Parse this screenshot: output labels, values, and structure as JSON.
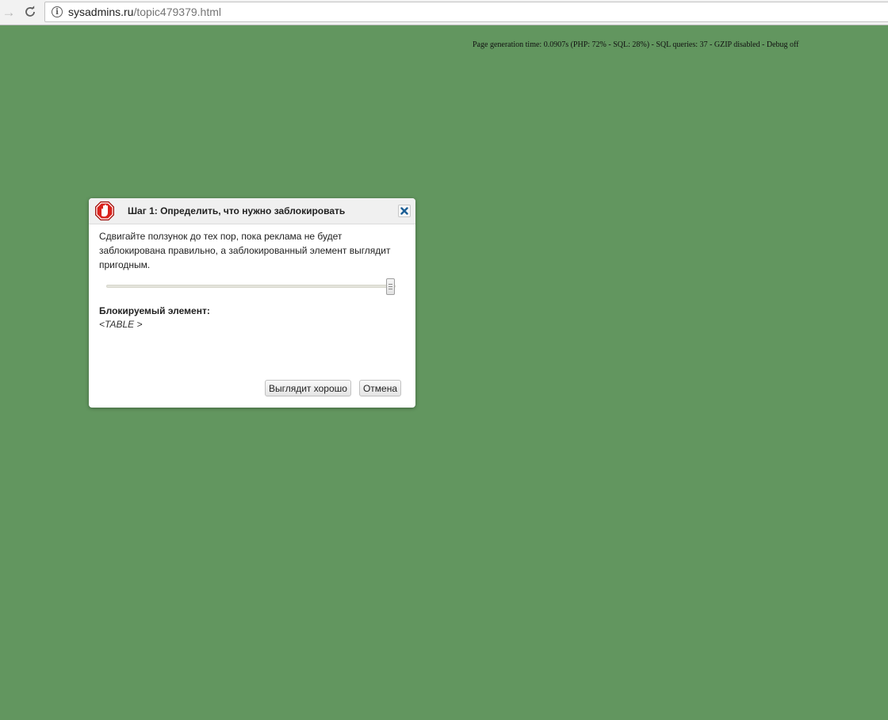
{
  "browser": {
    "url_host": "sysadmins.ru",
    "url_path": "/topic479379.html",
    "forward_icon": "arrow-right-icon",
    "reload_icon": "reload-icon",
    "site_info_icon": "info-icon"
  },
  "page": {
    "generation_info": "Page generation time: 0.0907s (PHP: 72% - SQL: 28%) - SQL queries: 37 - GZIP disabled - Debug off",
    "background_color": "#62965f"
  },
  "dialog": {
    "title": "Шаг 1: Определить, что нужно заблокировать",
    "logo_icon": "stop-hand-icon",
    "close_icon": "close-icon",
    "instruction": "Сдвигайте ползунок до тех пор, пока реклама не будет заблокирована правильно, а заблокированный элемент выглядит пригодным.",
    "slider_level": 1.0,
    "blocked_label": "Блокируемый элемент:",
    "blocked_value": "<TABLE >",
    "ok_button": "Выглядит хорошо",
    "cancel_button": "Отмена"
  }
}
